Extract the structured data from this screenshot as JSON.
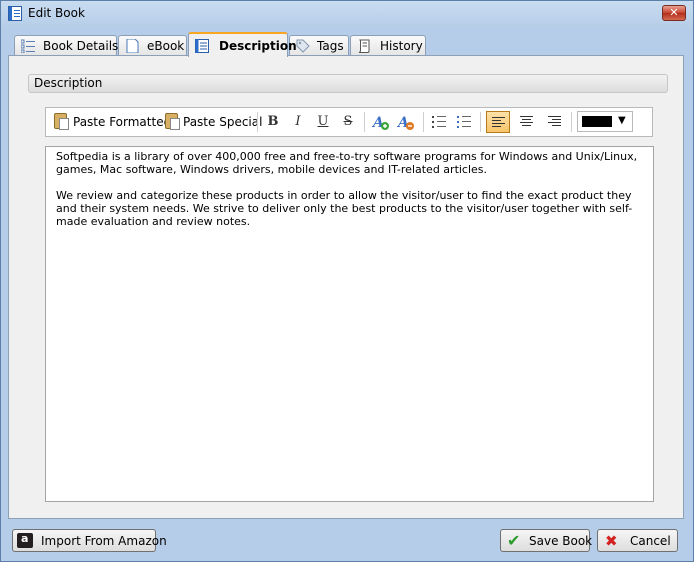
{
  "window": {
    "title": "Edit Book",
    "close_label": "✕"
  },
  "tabs": [
    {
      "label": "Book Details",
      "icon": "list-icon"
    },
    {
      "label": "eBook",
      "icon": "page-icon"
    },
    {
      "label": "Description",
      "icon": "document-icon"
    },
    {
      "label": "Tags",
      "icon": "tag-icon"
    },
    {
      "label": "History",
      "icon": "scroll-icon"
    }
  ],
  "section": {
    "title": "Description"
  },
  "toolbar": {
    "paste_formatted": "Paste Formatted",
    "paste_special": "Paste Special",
    "bold": "B",
    "italic": "I",
    "underline": "U",
    "strike": "S",
    "font_color": "#000000"
  },
  "editor": {
    "paragraphs": [
      "Softpedia is a library of over 400,000 free and free-to-try software programs for Windows and Unix/Linux, games, Mac software, Windows drivers, mobile devices and IT-related articles.",
      "We review and categorize these products in order to allow the visitor/user to find the exact product they and their system needs. We strive to deliver only the best products to the visitor/user together with self-made evaluation and review notes."
    ]
  },
  "buttons": {
    "import": "Import From Amazon",
    "save": "Save Book",
    "cancel": "Cancel"
  },
  "colors": {
    "accent": "#f6a623",
    "title_bar": "#b5cde8"
  }
}
